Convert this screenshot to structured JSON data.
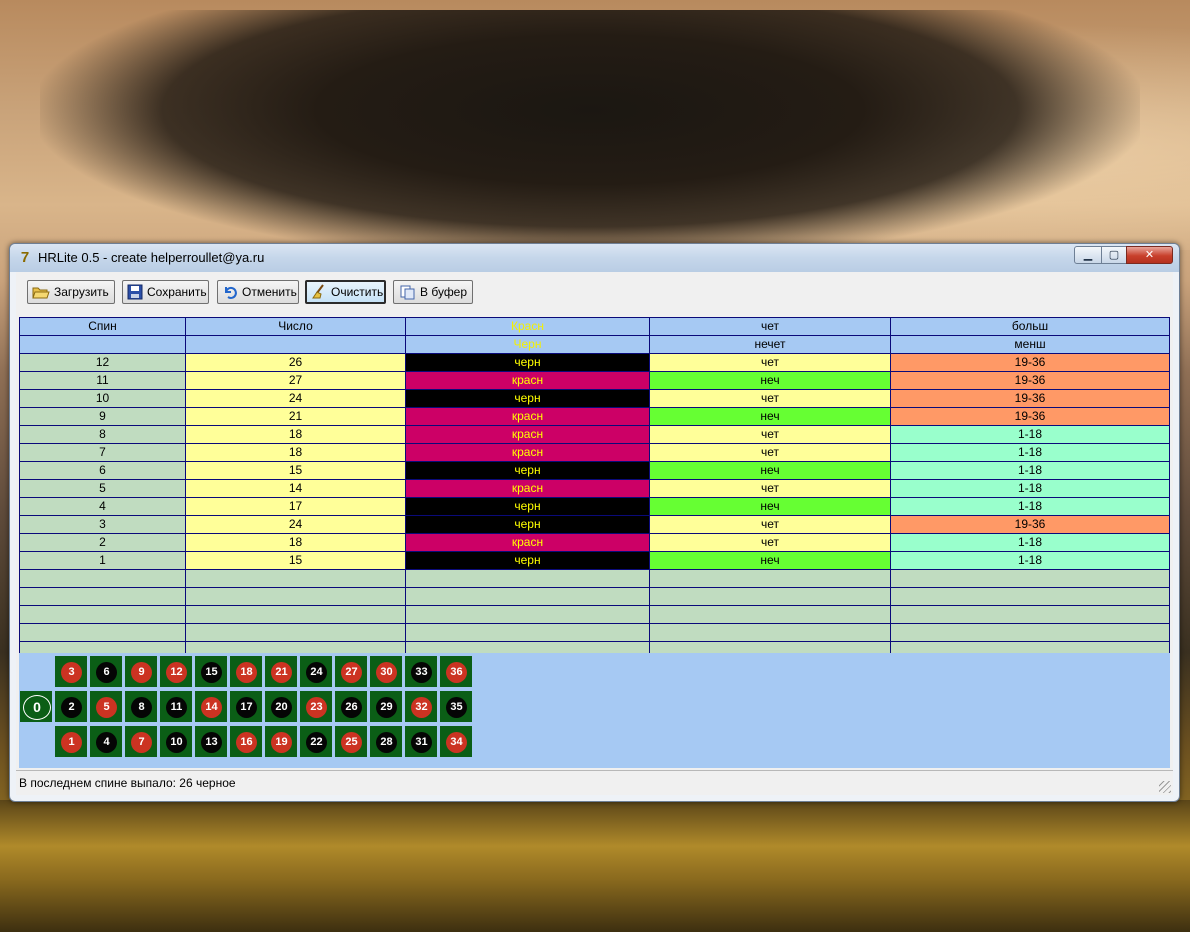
{
  "window": {
    "title": "HRLite 0.5 - create helperroullet@ya.ru",
    "app_icon": "7"
  },
  "controls": {
    "minimize": "▁",
    "maximize": "▢",
    "close": "✕"
  },
  "toolbar": {
    "load": "Загрузить",
    "save": "Сохранить",
    "undo": "Отменить",
    "clear": "Очистить",
    "copy": "В буфер"
  },
  "table": {
    "header1": [
      "Спин",
      "Число",
      "Красн",
      "чет",
      "больш"
    ],
    "header2": [
      "",
      "",
      "Черн",
      "нечет",
      "менш"
    ],
    "rows": [
      {
        "spin": "12",
        "num": "26",
        "color": "черн",
        "parity": "чет",
        "range": "19-36"
      },
      {
        "spin": "11",
        "num": "27",
        "color": "красн",
        "parity": "неч",
        "range": "19-36"
      },
      {
        "spin": "10",
        "num": "24",
        "color": "черн",
        "parity": "чет",
        "range": "19-36"
      },
      {
        "spin": "9",
        "num": "21",
        "color": "красн",
        "parity": "неч",
        "range": "19-36"
      },
      {
        "spin": "8",
        "num": "18",
        "color": "красн",
        "parity": "чет",
        "range": "1-18"
      },
      {
        "spin": "7",
        "num": "18",
        "color": "красн",
        "parity": "чет",
        "range": "1-18"
      },
      {
        "spin": "6",
        "num": "15",
        "color": "черн",
        "parity": "неч",
        "range": "1-18"
      },
      {
        "spin": "5",
        "num": "14",
        "color": "красн",
        "parity": "чет",
        "range": "1-18"
      },
      {
        "spin": "4",
        "num": "17",
        "color": "черн",
        "parity": "неч",
        "range": "1-18"
      },
      {
        "spin": "3",
        "num": "24",
        "color": "черн",
        "parity": "чет",
        "range": "19-36"
      },
      {
        "spin": "2",
        "num": "18",
        "color": "красн",
        "parity": "чет",
        "range": "1-18"
      },
      {
        "spin": "1",
        "num": "15",
        "color": "черн",
        "parity": "неч",
        "range": "1-18"
      }
    ],
    "empty_rows": 6
  },
  "board": {
    "zero": "0",
    "rows": [
      [
        {
          "n": "3",
          "c": "r"
        },
        {
          "n": "6",
          "c": "b"
        },
        {
          "n": "9",
          "c": "r"
        },
        {
          "n": "12",
          "c": "r"
        },
        {
          "n": "15",
          "c": "b"
        },
        {
          "n": "18",
          "c": "r"
        },
        {
          "n": "21",
          "c": "r"
        },
        {
          "n": "24",
          "c": "b"
        },
        {
          "n": "27",
          "c": "r"
        },
        {
          "n": "30",
          "c": "r"
        },
        {
          "n": "33",
          "c": "b"
        },
        {
          "n": "36",
          "c": "r"
        }
      ],
      [
        {
          "n": "2",
          "c": "b"
        },
        {
          "n": "5",
          "c": "r"
        },
        {
          "n": "8",
          "c": "b"
        },
        {
          "n": "11",
          "c": "b"
        },
        {
          "n": "14",
          "c": "r"
        },
        {
          "n": "17",
          "c": "b"
        },
        {
          "n": "20",
          "c": "b"
        },
        {
          "n": "23",
          "c": "r"
        },
        {
          "n": "26",
          "c": "b"
        },
        {
          "n": "29",
          "c": "b"
        },
        {
          "n": "32",
          "c": "r"
        },
        {
          "n": "35",
          "c": "b"
        }
      ],
      [
        {
          "n": "1",
          "c": "r"
        },
        {
          "n": "4",
          "c": "b"
        },
        {
          "n": "7",
          "c": "r"
        },
        {
          "n": "10",
          "c": "b"
        },
        {
          "n": "13",
          "c": "b"
        },
        {
          "n": "16",
          "c": "r"
        },
        {
          "n": "19",
          "c": "r"
        },
        {
          "n": "22",
          "c": "b"
        },
        {
          "n": "25",
          "c": "r"
        },
        {
          "n": "28",
          "c": "b"
        },
        {
          "n": "31",
          "c": "b"
        },
        {
          "n": "34",
          "c": "r"
        }
      ]
    ]
  },
  "status": {
    "text": "В последнем спине выпало: 26 черное"
  },
  "colors": {
    "header_bg": "#a6c9f3",
    "black_cell": "#000000",
    "red_cell": "#cc0066",
    "odd_cell": "#66ff33",
    "even_cell": "#ffff99",
    "high_cell": "#ff9966",
    "low_cell": "#99ffcc",
    "felt": "#0b5e16"
  }
}
